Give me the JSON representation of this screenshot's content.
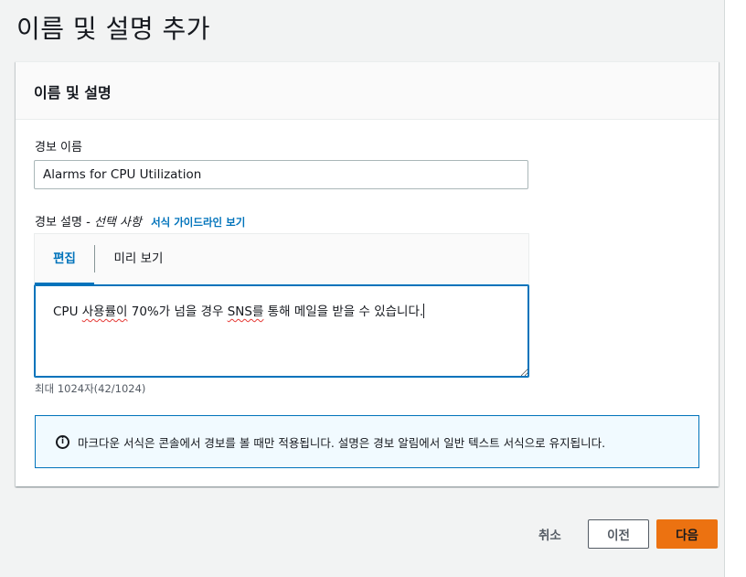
{
  "page": {
    "title": "이름 및 설명 추가"
  },
  "panel": {
    "header": "이름 및 설명",
    "alarm_name": {
      "label": "경보 이름",
      "value": "Alarms for CPU Utilization"
    },
    "description": {
      "label": "경보 설명",
      "optional": "- 선택 사항",
      "info_link": "서식 가이드라인 보기",
      "tabs": [
        "편집",
        "미리 보기"
      ],
      "active_tab": "편집",
      "text_prefix": "CPU ",
      "text_sq1": "사용률이",
      "text_mid": " 70%가 넘을 경우 ",
      "text_sq2": "SNS를",
      "text_suffix": " 통해 메일을 받을 수 있습니다.",
      "constraint": "최대 1024자(42/1024)"
    },
    "info_alert": {
      "icon": "info-icon",
      "text": "마크다운 서식은 콘솔에서 경보를 볼 때만 적용됩니다. 설명은 경보 알림에서 일반 텍스트 서식으로 유지됩니다."
    }
  },
  "footer": {
    "cancel": "취소",
    "previous": "이전",
    "next": "다음"
  },
  "colors": {
    "accent": "#0073bb",
    "primary_button": "#ec7211",
    "background": "#f2f3f3"
  }
}
